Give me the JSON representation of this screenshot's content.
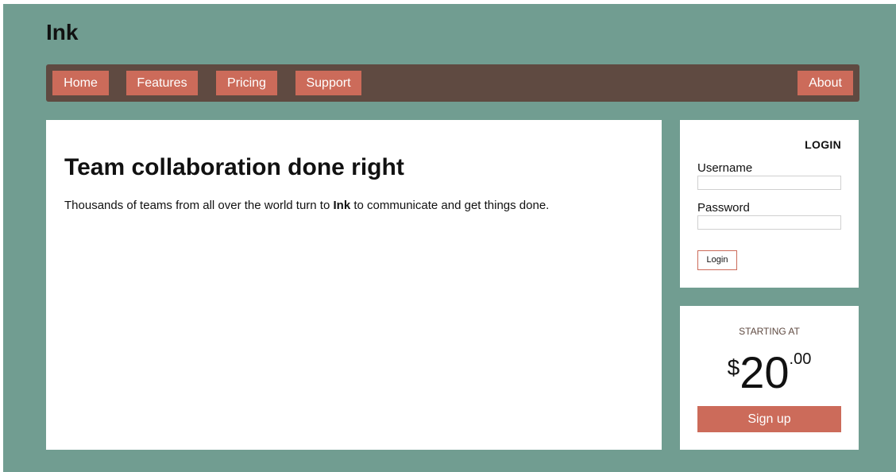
{
  "brand": {
    "name": "Ink"
  },
  "nav": {
    "items": [
      {
        "label": "Home"
      },
      {
        "label": "Features"
      },
      {
        "label": "Pricing"
      },
      {
        "label": "Support"
      }
    ],
    "right_item": {
      "label": "About"
    }
  },
  "main": {
    "heading": "Team collaboration done right",
    "paragraph_before": "Thousands of teams from all over the world turn to ",
    "paragraph_bold": "Ink",
    "paragraph_after": " to communicate and get things done."
  },
  "login": {
    "title": "LOGIN",
    "username_label": "Username",
    "username_value": "",
    "password_label": "Password",
    "password_value": "",
    "button_label": "Login"
  },
  "pricing": {
    "starting_label": "STARTING AT",
    "currency": "$",
    "amount": "20",
    "cents": ".00",
    "signup_label": "Sign up"
  },
  "colors": {
    "background": "#719d91",
    "navbar": "#5f4a41",
    "accent": "#cc6b5a",
    "panel": "#ffffff"
  }
}
